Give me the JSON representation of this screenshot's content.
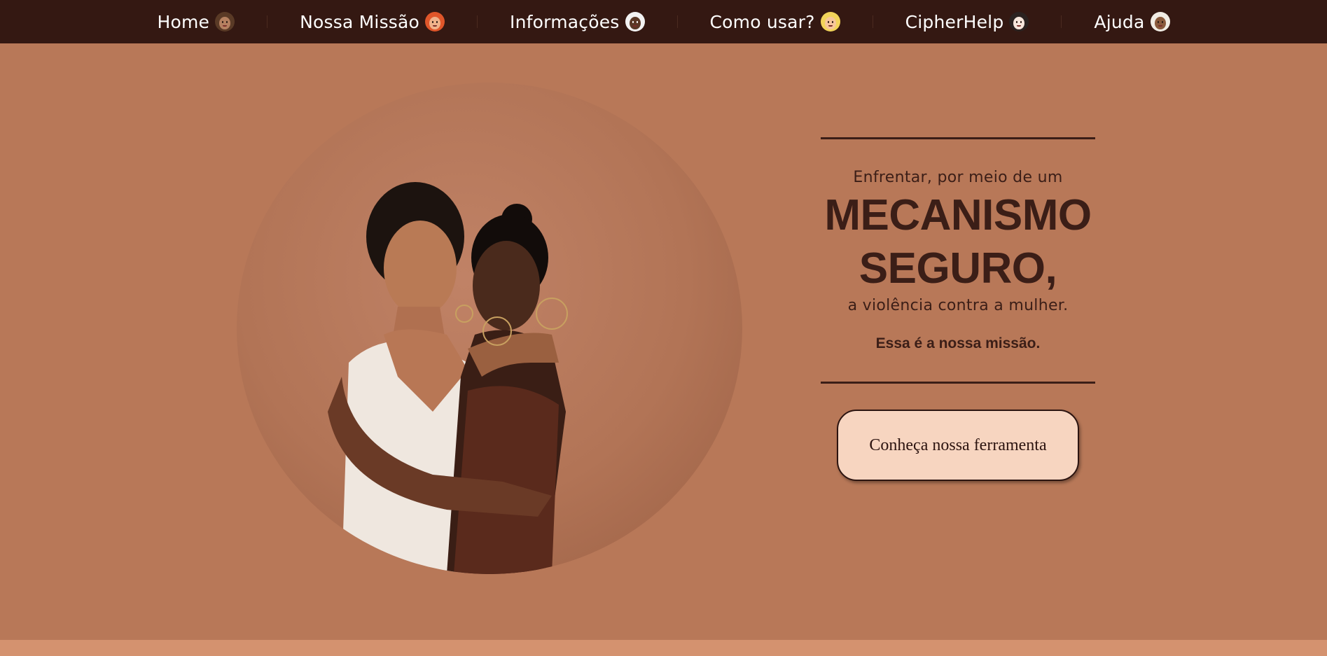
{
  "nav": {
    "items": [
      {
        "label": "Home",
        "icon": "woman-medium-skin-icon"
      },
      {
        "label": "Nossa Missão",
        "icon": "woman-red-hair-icon"
      },
      {
        "label": "Informações",
        "icon": "woman-white-hair-dark-skin-icon"
      },
      {
        "label": "Como usar?",
        "icon": "woman-blonde-icon"
      },
      {
        "label": "CipherHelp",
        "icon": "woman-dark-hair-icon"
      },
      {
        "label": "Ajuda",
        "icon": "woman-headscarf-icon"
      }
    ]
  },
  "hero": {
    "pre": "Enfrentar, por meio de um",
    "headline_line1": "MECANISMO",
    "headline_line2": "SEGURO,",
    "post": "a violência contra a mulher.",
    "mission": "Essa é a nossa missão.",
    "cta_label": "Conheça nossa ferramenta"
  },
  "colors": {
    "nav_bg": "#341812",
    "page_bg": "#b87858",
    "text_dark": "#3b1e17",
    "button_bg": "#f7d5c0",
    "bottom_band": "#d4926f"
  }
}
